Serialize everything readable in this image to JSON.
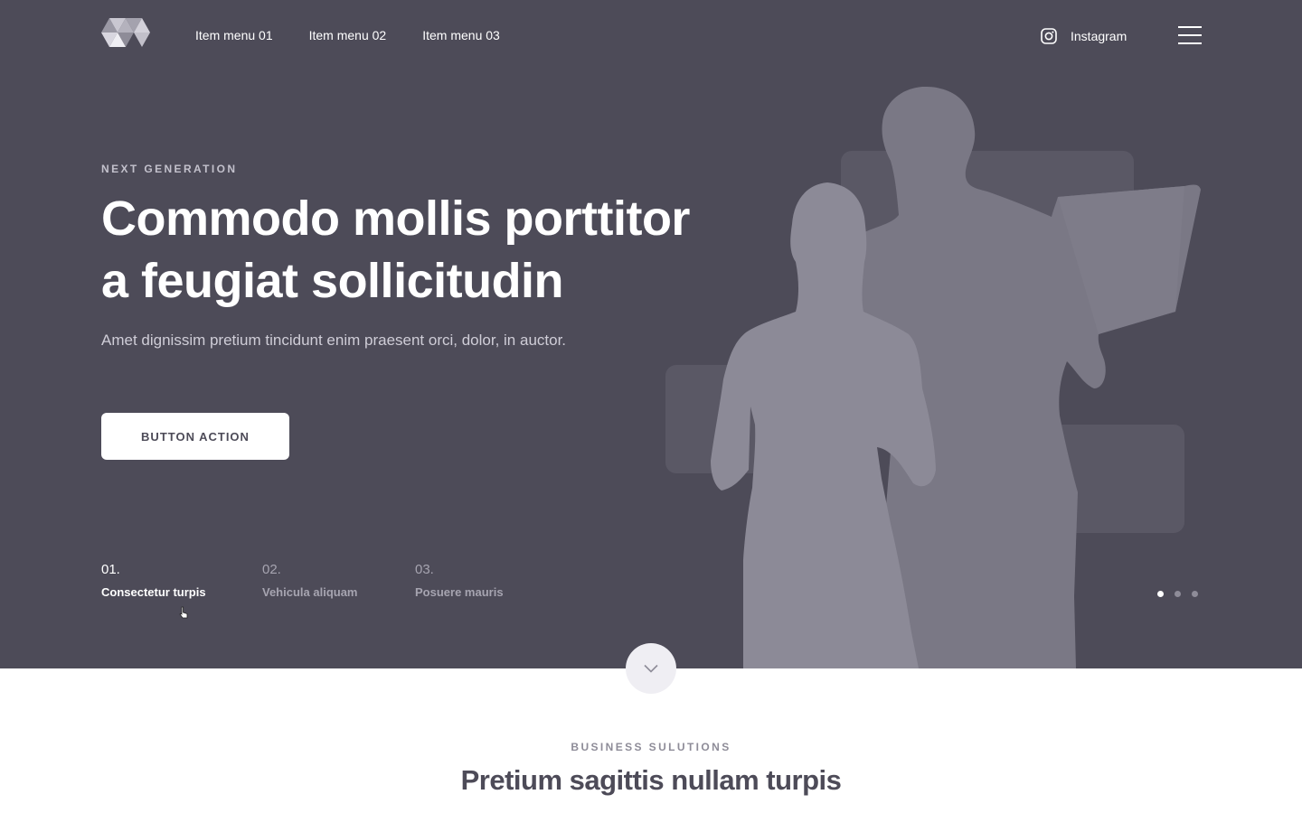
{
  "header": {
    "logo": "logo-triangles",
    "nav": [
      "Item menu 01",
      "Item menu 02",
      "Item menu 03"
    ],
    "instagram_label": "Instagram",
    "menu_icon": "hamburger-icon"
  },
  "hero": {
    "eyebrow": "NEXT GENERATION",
    "headline_line1": "Commodo mollis porttitor",
    "headline_line2": "a feugiat sollicitudin",
    "subtitle": "Amet dignissim pretium tincidunt enim praesent orci, dolor, in auctor.",
    "cta_label": "BUTTON ACTION",
    "slides": [
      {
        "num": "01.",
        "label": "Consectetur turpis",
        "active": true
      },
      {
        "num": "02.",
        "label": "Vehicula aliquam",
        "active": false
      },
      {
        "num": "03.",
        "label": "Posuere mauris",
        "active": false
      }
    ],
    "dots": {
      "count": 3,
      "active": 1
    }
  },
  "scroll_button_icon": "chevron-down-icon",
  "section": {
    "eyebrow": "BUSINESS SULUTIONS",
    "title": "Pretium sagittis nullam turpis"
  },
  "colors": {
    "hero_bg": "#4d4b58",
    "silhouette_front": "#8c8a97",
    "silhouette_back": "#7a7885",
    "card": "#5a5865"
  }
}
